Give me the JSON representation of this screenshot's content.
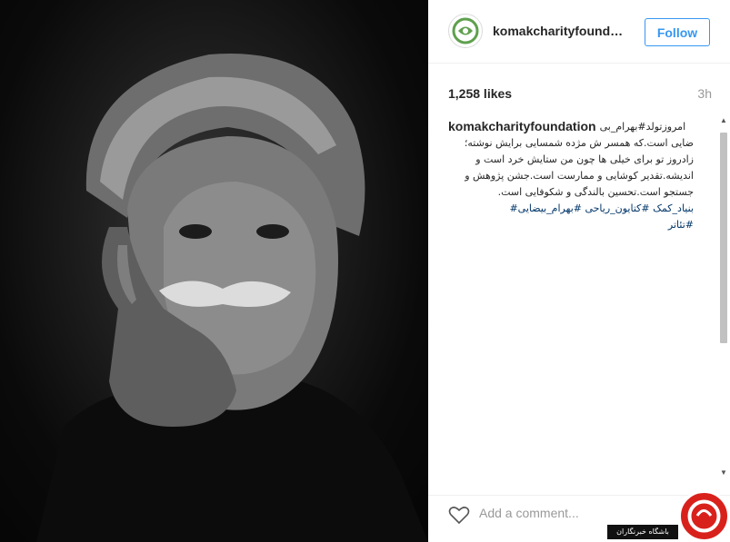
{
  "post": {
    "username": "komakcharityfound…",
    "follow_label": "Follow",
    "likes": "1,258 likes",
    "time_ago": "3h",
    "caption_user": "komakcharityfoundation",
    "caption_lines": [
      "امروزتولد#بهرام_بی",
      "ضایی است.که همسر ش مژده شمسایی برایش نوشته؛",
      "زادروز تو برای خیلی ها چون من ستایش خرد است و",
      "اندیشه.تقدیر کوشایی و ممارست است.جشن پژوهش و",
      "جستجو است.تحسین بالندگی و شکوفایی است.",
      "بنیاد_کمک  #کتایون_ریاحی  #بهرام_بیضایی#",
      "#تئاتر"
    ],
    "comment_placeholder": "Add a comment..."
  },
  "watermark": {
    "text": "باشگاه خبرنگاران"
  },
  "colors": {
    "follow": "#3897f0",
    "hashtag": "#003569",
    "brand_logo": "#5fa04e",
    "watermark_red": "#d9211c"
  },
  "icons": {
    "avatar": "komak-logo-icon",
    "heart": "heart-icon",
    "scroll_up": "scroll-up-arrow-icon",
    "scroll_down": "scroll-down-arrow-icon"
  }
}
